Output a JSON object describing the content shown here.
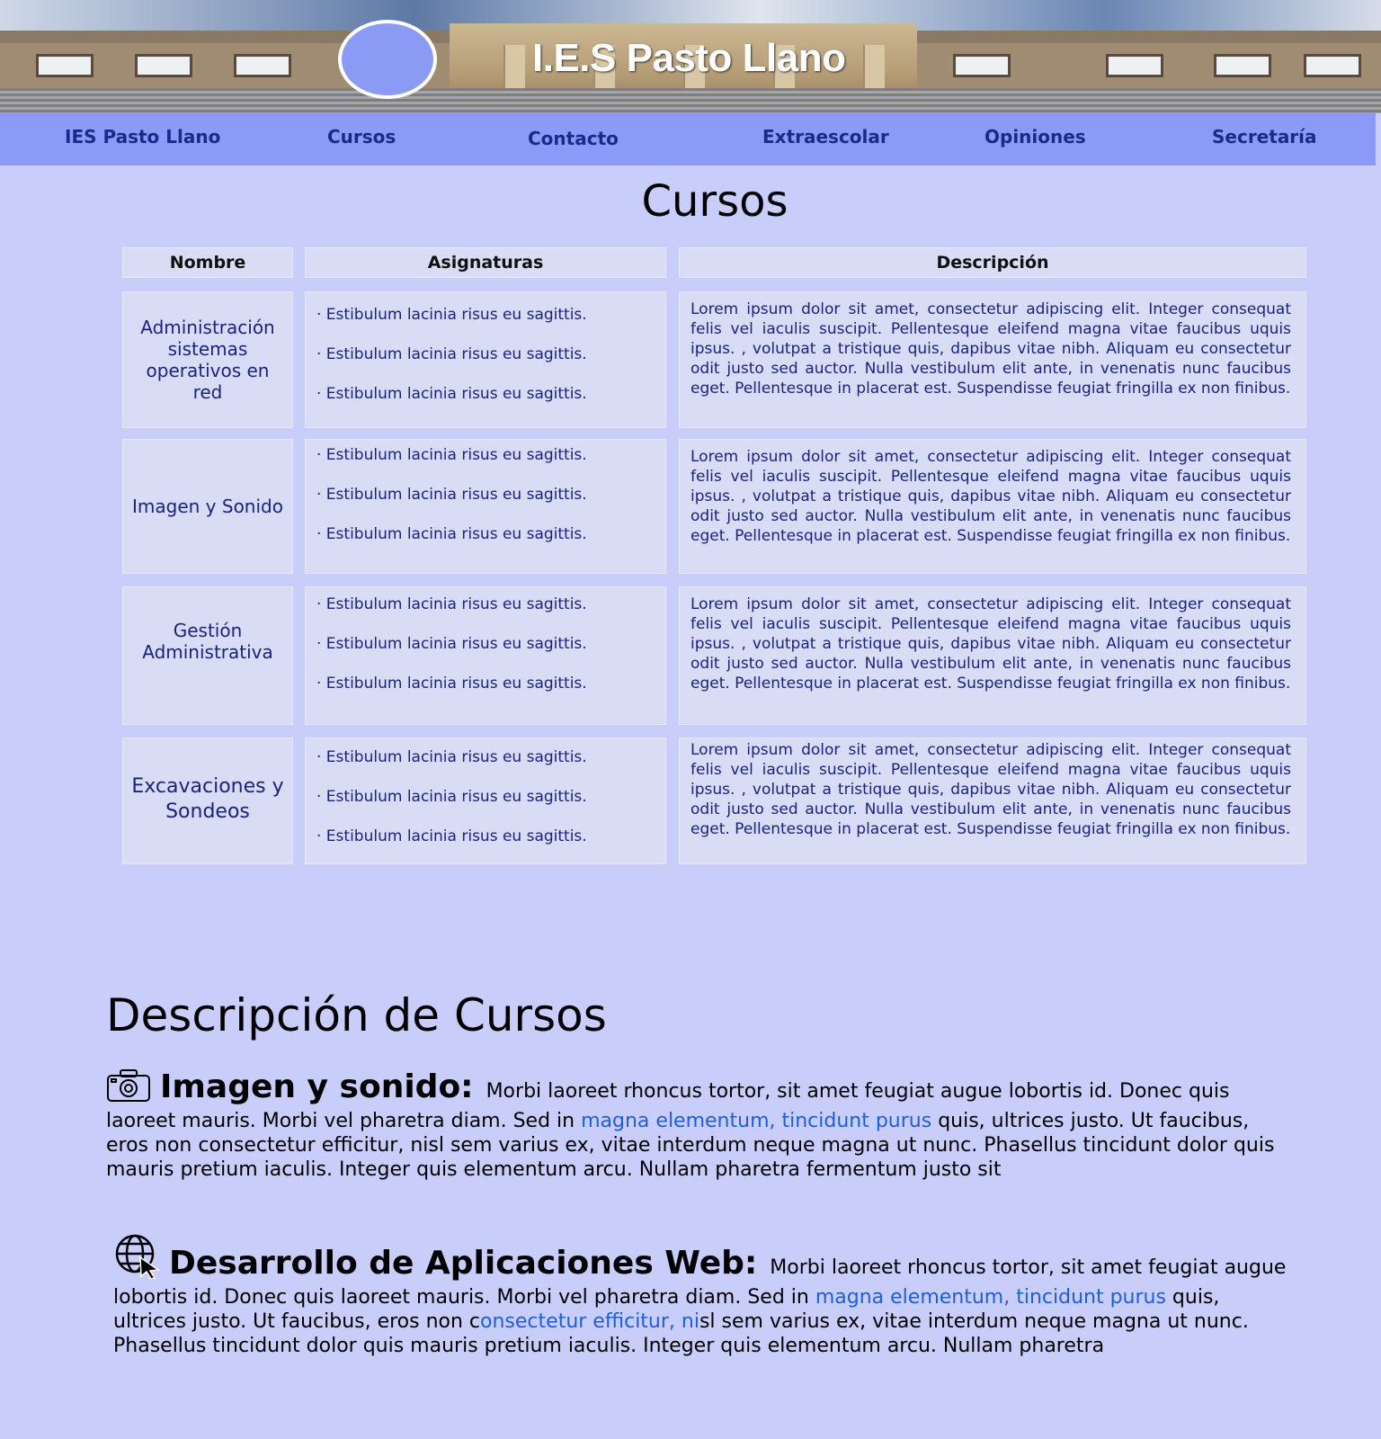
{
  "banner": {
    "title": "I.E.S Pasto Llano"
  },
  "nav": {
    "items": [
      "IES Pasto Llano",
      "Cursos",
      "Contacto",
      "Extraescolar",
      "Opiniones",
      "Secretaría"
    ]
  },
  "page_title": "Cursos",
  "table": {
    "headers": [
      "Nombre",
      "Asignaturas",
      "Descripción"
    ],
    "rows": [
      {
        "name": "Administración sistemas operativos en red",
        "subjects": [
          "· Estibulum lacinia risus eu sagittis.",
          "· Estibulum lacinia risus eu sagittis.",
          "· Estibulum lacinia risus eu sagittis."
        ],
        "description": "Lorem ipsum dolor sit amet, consectetur adipiscing elit. Integer consequat felis vel iaculis suscipit. Pellentesque eleifend magna vitae faucibus uquis ipsus. , volutpat a tristique quis, dapibus vitae nibh. Aliquam eu consectetur odit justo sed auctor. Nulla vestibulum elit ante, in venenatis nunc faucibus eget. Pellentesque in placerat est. Suspendisse feugiat fringilla ex non finibus."
      },
      {
        "name": "Imagen y Sonido",
        "subjects": [
          "· Estibulum lacinia risus eu sagittis.",
          "· Estibulum lacinia risus eu sagittis.",
          "· Estibulum lacinia risus eu sagittis."
        ],
        "description": "Lorem ipsum dolor sit amet, consectetur adipiscing elit. Integer consequat felis vel iaculis suscipit. Pellentesque eleifend magna vitae faucibus uquis ipsus. , volutpat a tristique quis, dapibus vitae nibh. Aliquam eu consectetur odit justo sed auctor. Nulla vestibulum elit ante, in venenatis nunc faucibus eget. Pellentesque in placerat est. Suspendisse feugiat fringilla ex non finibus."
      },
      {
        "name": "Gestión Administrativa",
        "subjects": [
          "· Estibulum lacinia risus eu sagittis.",
          "· Estibulum lacinia risus eu sagittis.",
          "· Estibulum lacinia risus eu sagittis."
        ],
        "description": "Lorem ipsum dolor sit amet, consectetur adipiscing elit. Integer consequat felis vel iaculis suscipit. Pellentesque eleifend magna vitae faucibus uquis ipsus. , volutpat a tristique quis, dapibus vitae nibh. Aliquam eu consectetur odit justo sed auctor. Nulla vestibulum elit ante, in venenatis nunc faucibus eget. Pellentesque in placerat est. Suspendisse feugiat fringilla ex non finibus."
      },
      {
        "name": "Excavaciones y Sondeos",
        "subjects": [
          "· Estibulum lacinia risus eu sagittis.",
          "· Estibulum lacinia risus eu sagittis.",
          "· Estibulum lacinia risus eu sagittis."
        ],
        "description": "Lorem ipsum dolor sit amet, consectetur adipiscing elit. Integer consequat felis vel iaculis suscipit. Pellentesque eleifend magna vitae faucibus uquis ipsus. , volutpat a tristique quis, dapibus vitae nibh. Aliquam eu consectetur odit justo sed auctor. Nulla vestibulum elit ante, in venenatis nunc faucibus eget. Pellentesque in placerat est. Suspendisse feugiat fringilla ex non finibus."
      }
    ]
  },
  "descriptions": {
    "title": "Descripción de Cursos",
    "items": [
      {
        "icon": "camera-icon",
        "heading": "Imagen y sonido:",
        "text_before": "Morbi laoreet rhoncus tortor, sit amet feugiat augue lobortis id. Donec quis laoreet mauris. Morbi vel pharetra diam. Sed in ",
        "link1": "magna elementum, tincidunt purus",
        "text_after": " quis, ultrices justo. Ut faucibus, eros non consectetur efficitur, nisl sem varius ex, vitae interdum neque magna ut nunc. Phasellus tincidunt dolor quis mauris pretium iaculis. Integer quis elementum arcu. Nullam pharetra fermentum justo sit"
      },
      {
        "icon": "globe-cursor-icon",
        "heading": "Desarrollo de Aplicaciones Web:",
        "text_before": "Morbi laoreet rhoncus tortor, sit amet feugiat augue lobortis id. Donec quis laoreet mauris. Morbi vel pharetra diam. Sed in ",
        "link1": "magna elementum, tincidunt purus",
        "text_middle": " quis, ultrices justo. Ut faucibus, eros non c",
        "link2": "onsectetur efficitur, ni",
        "text_after": "sl sem varius ex, vitae interdum neque magna ut nunc. Phasellus tincidunt dolor quis mauris pretium iaculis. Integer quis elementum arcu. Nullam pharetra"
      }
    ]
  },
  "colors": {
    "background": "#c8cdfa",
    "nav_background": "#8b9af7",
    "nav_text": "#1a2a8a",
    "table_cell": "#d8dcf5",
    "link": "#1e5fd9"
  }
}
